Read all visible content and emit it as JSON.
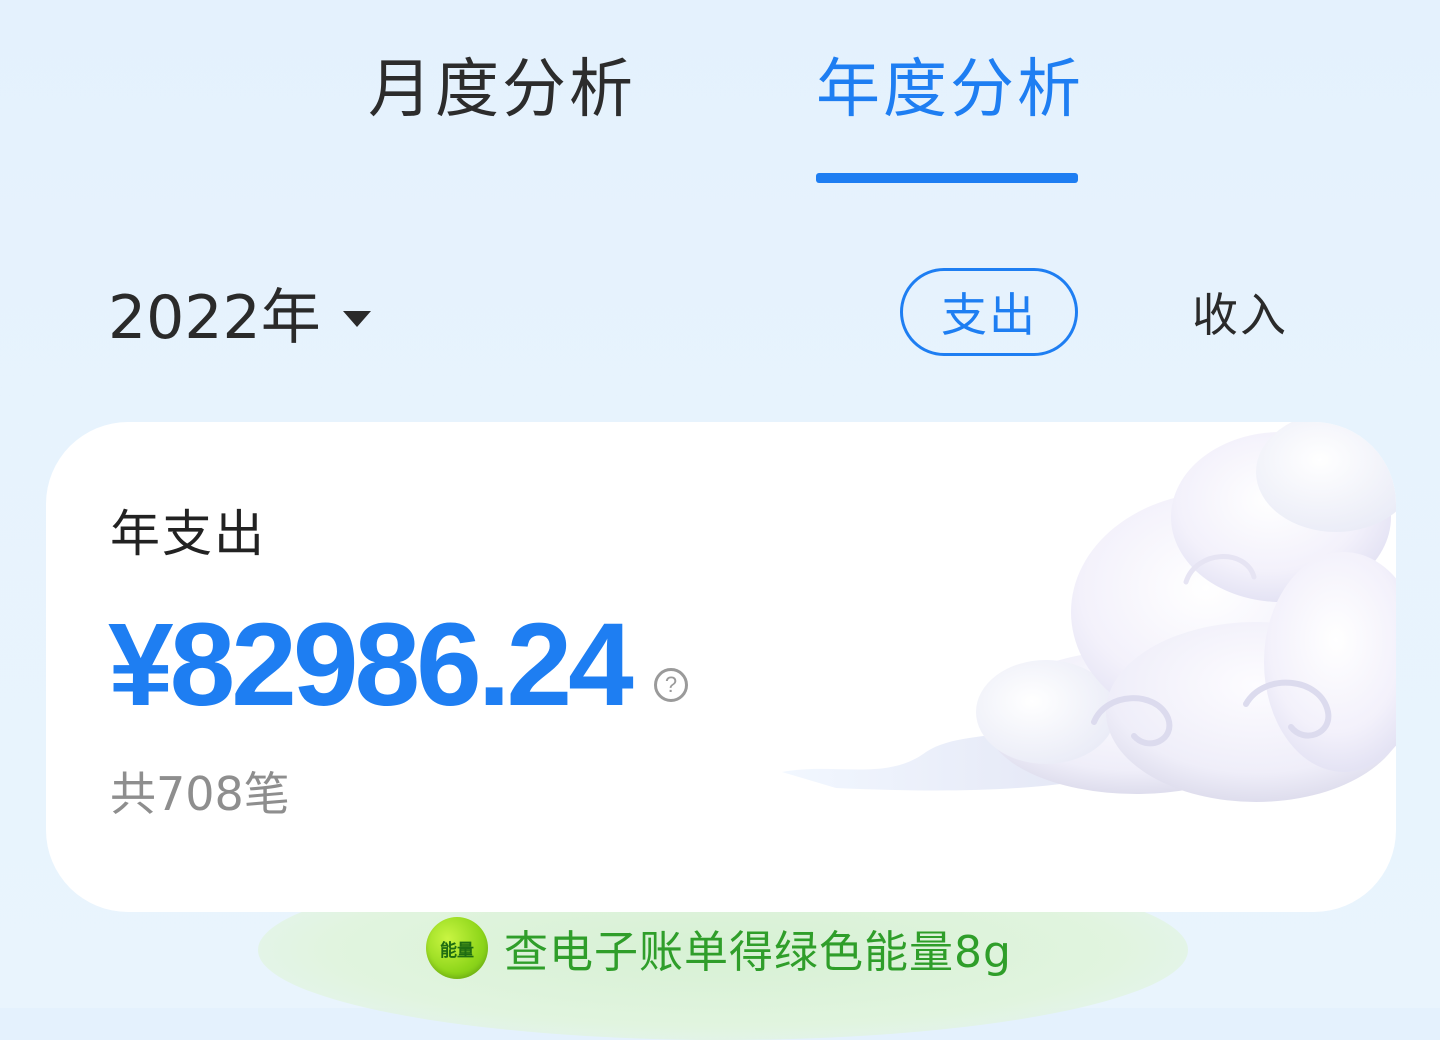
{
  "tabs": {
    "monthly": "月度分析",
    "yearly": "年度分析",
    "active": "yearly"
  },
  "year_selector": {
    "value": "2022年"
  },
  "toggle": {
    "expense": "支出",
    "income": "收入",
    "active": "expense"
  },
  "summary_card": {
    "title": "年支出",
    "amount": "¥82986.24",
    "help": "?",
    "count": "共708笔"
  },
  "energy_banner": {
    "badge": "能量",
    "text": "查电子账单得绿色能量8g"
  },
  "colors": {
    "accent": "#1e7ef2",
    "background": "#e6f2fd",
    "card": "#ffffff",
    "energy_text": "#2f9e2a"
  }
}
